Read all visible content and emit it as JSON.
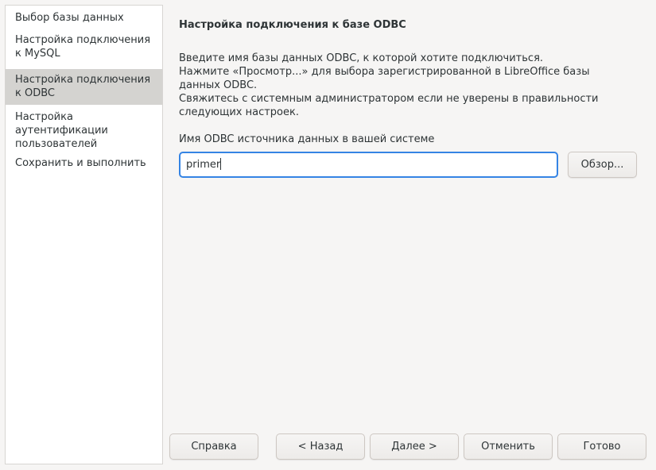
{
  "sidebar": {
    "items": [
      {
        "lines": [
          "Выбор базы данных"
        ],
        "selected": false
      },
      {
        "lines": [
          "Настройка подключения",
          "к MySQL"
        ],
        "selected": false
      },
      {
        "lines": [
          "Настройка подключения",
          "к ODBC"
        ],
        "selected": true
      },
      {
        "lines": [
          "Настройка",
          "аутентификации",
          "пользователей"
        ],
        "selected": false
      },
      {
        "lines": [
          "Сохранить и выполнить"
        ],
        "selected": false
      }
    ]
  },
  "main": {
    "title": "Настройка подключения к базе ODBC",
    "description": [
      "Введите имя базы данных ODBC, к которой хотите подключиться.",
      "Нажмите «Просмотр...» для выбора зарегистрированной в LibreOffice базы",
      "данных ODBC.",
      "Свяжитесь с системным администратором если не уверены в правильности",
      "следующих настроек."
    ],
    "field_label": "Имя ODBC источника данных в вашей системе",
    "field_value": "primer",
    "browse_label": "Обзор..."
  },
  "footer": {
    "help": "Справка",
    "back": "< Назад",
    "next": "Далее >",
    "cancel": "Отменить",
    "finish": "Готово"
  },
  "colors": {
    "selected_bg": "#d4d3d0",
    "focus_border": "#3584e4"
  }
}
